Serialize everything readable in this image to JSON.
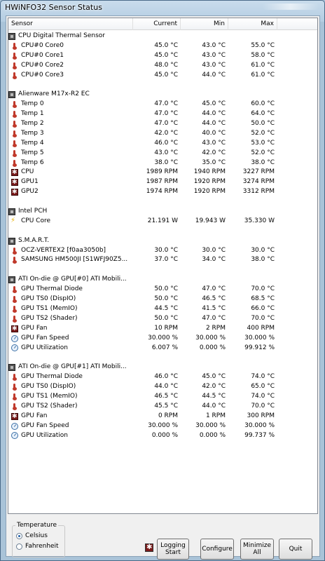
{
  "window": {
    "title": "HWiNFO32 Sensor Status"
  },
  "columns": {
    "sensor": "Sensor",
    "current": "Current",
    "min": "Min",
    "max": "Max"
  },
  "rows": [
    {
      "type": "group",
      "icon": "chip-icon",
      "name": "CPU Digital Thermal Sensor"
    },
    {
      "type": "item",
      "icon": "thermometer-icon",
      "name": "CPU#0 Core0",
      "current": "45.0 °C",
      "min": "43.0 °C",
      "max": "55.0 °C"
    },
    {
      "type": "item",
      "icon": "thermometer-icon",
      "name": "CPU#0 Core1",
      "current": "45.0 °C",
      "min": "43.0 °C",
      "max": "58.0 °C"
    },
    {
      "type": "item",
      "icon": "thermometer-icon",
      "name": "CPU#0 Core2",
      "current": "48.0 °C",
      "min": "43.0 °C",
      "max": "61.0 °C"
    },
    {
      "type": "item",
      "icon": "thermometer-icon",
      "name": "CPU#0 Core3",
      "current": "45.0 °C",
      "min": "44.0 °C",
      "max": "61.0 °C"
    },
    {
      "type": "blank"
    },
    {
      "type": "group",
      "icon": "chip-icon",
      "name": "Alienware M17x-R2 EC"
    },
    {
      "type": "item",
      "icon": "thermometer-icon",
      "name": "Temp 0",
      "current": "47.0 °C",
      "min": "45.0 °C",
      "max": "60.0 °C"
    },
    {
      "type": "item",
      "icon": "thermometer-icon",
      "name": "Temp 1",
      "current": "47.0 °C",
      "min": "44.0 °C",
      "max": "64.0 °C"
    },
    {
      "type": "item",
      "icon": "thermometer-icon",
      "name": "Temp 2",
      "current": "47.0 °C",
      "min": "44.0 °C",
      "max": "50.0 °C"
    },
    {
      "type": "item",
      "icon": "thermometer-icon",
      "name": "Temp 3",
      "current": "42.0 °C",
      "min": "40.0 °C",
      "max": "52.0 °C"
    },
    {
      "type": "item",
      "icon": "thermometer-icon",
      "name": "Temp 4",
      "current": "46.0 °C",
      "min": "43.0 °C",
      "max": "53.0 °C"
    },
    {
      "type": "item",
      "icon": "thermometer-icon",
      "name": "Temp 5",
      "current": "43.0 °C",
      "min": "42.0 °C",
      "max": "52.0 °C"
    },
    {
      "type": "item",
      "icon": "thermometer-icon",
      "name": "Temp 6",
      "current": "38.0 °C",
      "min": "35.0 °C",
      "max": "38.0 °C"
    },
    {
      "type": "item",
      "icon": "fan-icon",
      "name": "CPU",
      "current": "1989 RPM",
      "min": "1940 RPM",
      "max": "3227 RPM"
    },
    {
      "type": "item",
      "icon": "fan-icon",
      "name": "GPU1",
      "current": "1987 RPM",
      "min": "1920 RPM",
      "max": "3274 RPM"
    },
    {
      "type": "item",
      "icon": "fan-icon",
      "name": "GPU2",
      "current": "1974 RPM",
      "min": "1920 RPM",
      "max": "3312 RPM"
    },
    {
      "type": "blank"
    },
    {
      "type": "group",
      "icon": "chip-icon",
      "name": "Intel PCH"
    },
    {
      "type": "item",
      "icon": "power-icon",
      "name": "CPU Core",
      "current": "21.191 W",
      "min": "19.943 W",
      "max": "35.330 W"
    },
    {
      "type": "blank"
    },
    {
      "type": "group",
      "icon": "chip-icon",
      "name": "S.M.A.R.T."
    },
    {
      "type": "item",
      "icon": "thermometer-icon",
      "name": "OCZ-VERTEX2 [f0aa3050b]",
      "current": "30.0 °C",
      "min": "30.0 °C",
      "max": "30.0 °C"
    },
    {
      "type": "item",
      "icon": "thermometer-icon",
      "name": "SAMSUNG HM500JI [S1WFJ90Z5...",
      "current": "37.0 °C",
      "min": "34.0 °C",
      "max": "38.0 °C"
    },
    {
      "type": "blank"
    },
    {
      "type": "group",
      "icon": "chip-icon",
      "name": "ATI On-die @ GPU[#0] ATI Mobili..."
    },
    {
      "type": "item",
      "icon": "thermometer-icon",
      "name": "GPU Thermal Diode",
      "current": "50.0 °C",
      "min": "47.0 °C",
      "max": "70.0 °C"
    },
    {
      "type": "item",
      "icon": "thermometer-icon",
      "name": "GPU TS0 (DispIO)",
      "current": "50.0 °C",
      "min": "46.5 °C",
      "max": "68.5 °C"
    },
    {
      "type": "item",
      "icon": "thermometer-icon",
      "name": "GPU TS1 (MemIO)",
      "current": "44.5 °C",
      "min": "41.5 °C",
      "max": "66.0 °C"
    },
    {
      "type": "item",
      "icon": "thermometer-icon",
      "name": "GPU TS2 (Shader)",
      "current": "50.0 °C",
      "min": "47.0 °C",
      "max": "70.0 °C"
    },
    {
      "type": "item",
      "icon": "fan-icon",
      "name": "GPU Fan",
      "current": "10 RPM",
      "min": "2 RPM",
      "max": "400 RPM"
    },
    {
      "type": "item",
      "icon": "gauge-icon",
      "name": "GPU Fan Speed",
      "current": "30.000 %",
      "min": "30.000 %",
      "max": "30.000 %"
    },
    {
      "type": "item",
      "icon": "gauge-icon",
      "name": "GPU Utilization",
      "current": "6.007 %",
      "min": "0.000 %",
      "max": "99.912 %"
    },
    {
      "type": "blank"
    },
    {
      "type": "group",
      "icon": "chip-icon",
      "name": "ATI On-die @ GPU[#1] ATI Mobili..."
    },
    {
      "type": "item",
      "icon": "thermometer-icon",
      "name": "GPU Thermal Diode",
      "current": "46.0 °C",
      "min": "45.0 °C",
      "max": "74.0 °C"
    },
    {
      "type": "item",
      "icon": "thermometer-icon",
      "name": "GPU TS0 (DispIO)",
      "current": "44.0 °C",
      "min": "42.0 °C",
      "max": "65.0 °C"
    },
    {
      "type": "item",
      "icon": "thermometer-icon",
      "name": "GPU TS1 (MemIO)",
      "current": "46.5 °C",
      "min": "44.5 °C",
      "max": "74.0 °C"
    },
    {
      "type": "item",
      "icon": "thermometer-icon",
      "name": "GPU TS2 (Shader)",
      "current": "45.5 °C",
      "min": "44.0 °C",
      "max": "70.0 °C"
    },
    {
      "type": "item",
      "icon": "fan-icon",
      "name": "GPU Fan",
      "current": "0 RPM",
      "min": "1 RPM",
      "max": "300 RPM"
    },
    {
      "type": "item",
      "icon": "gauge-icon",
      "name": "GPU Fan Speed",
      "current": "30.000 %",
      "min": "30.000 %",
      "max": "30.000 %"
    },
    {
      "type": "item",
      "icon": "gauge-icon",
      "name": "GPU Utilization",
      "current": "0.000 %",
      "min": "0.000 %",
      "max": "99.737 %"
    }
  ],
  "temperature": {
    "label": "Temperature",
    "celsius": "Celsius",
    "fahrenheit": "Fahrenheit",
    "selected": "Celsius"
  },
  "buttons": {
    "logging": "Logging\nStart",
    "configure": "Configure",
    "minimize": "Minimize\nAll",
    "quit": "Quit"
  }
}
